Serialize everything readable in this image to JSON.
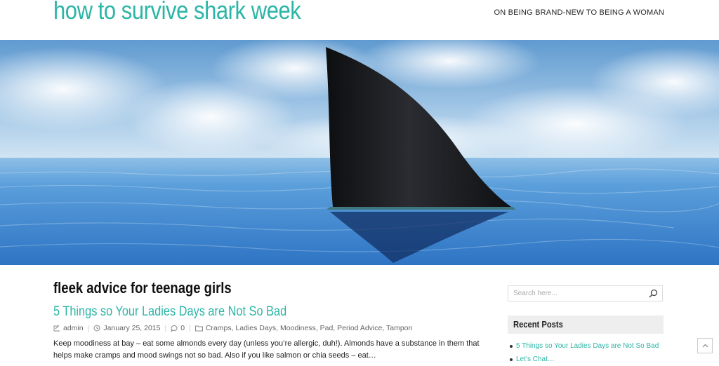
{
  "header": {
    "site_title": "how to survive shark week",
    "tagline": "ON BEING BRAND-NEW TO BEING A WOMAN"
  },
  "hero": {
    "image_subject": "shark-fin-in-ocean",
    "colors": {
      "sky_top": "#6ea6d6",
      "sky_bottom": "#cfe4f3",
      "sea": "#3f8ad0",
      "fin": "#141518"
    }
  },
  "main": {
    "archive_title": "fleek advice for teenage girls",
    "post": {
      "title": "5 Things so Your Ladies Days are Not So Bad",
      "author": "admin",
      "date": "January 25, 2015",
      "comments": "0",
      "categories": "Cramps, Ladies Days, Moodiness, Pad, Period Advice, Tampon",
      "excerpt": "Keep moodiness at bay – eat some almonds every day (unless you’re allergic, duh!). Almonds have a substance in them that helps make cramps and mood swings not so bad. Also if you like salmon or chia seeds – eat…"
    }
  },
  "sidebar": {
    "search": {
      "placeholder": "Search here..."
    },
    "recent_posts": {
      "title": "Recent Posts",
      "items": [
        "5 Things so Your Ladies Days are Not So Bad",
        "Let’s Chat…"
      ]
    }
  },
  "colors": {
    "accent": "#2bb5a6",
    "text": "#222222",
    "meta": "#666666"
  },
  "icons": [
    "author-icon",
    "clock-icon",
    "comment-icon",
    "folder-icon",
    "search-icon",
    "chevron-up-icon"
  ]
}
